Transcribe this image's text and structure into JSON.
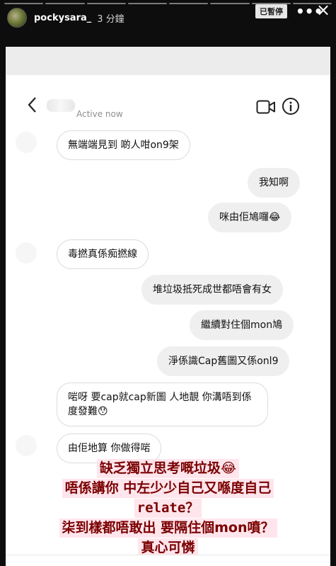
{
  "story": {
    "username": "pockysara_",
    "time": "3 分鐘",
    "paused_label": "已暫停",
    "more_icon": "more-dots-icon",
    "close_label": "×"
  },
  "dm": {
    "back_icon": "chevron-left-icon",
    "status": "Active now",
    "video_icon": "video-call-icon",
    "info_icon": "info-icon"
  },
  "messages": [
    {
      "side": "left",
      "text": "無端端見到 啲人咁on9架"
    },
    {
      "side": "right",
      "text": "我知啊"
    },
    {
      "side": "right",
      "text": "咪由佢鳩囉😂"
    },
    {
      "side": "left",
      "text": "毒撚真係痴撚線"
    },
    {
      "side": "right",
      "text": "堆垃圾抵死成世都唔會有女"
    },
    {
      "side": "right",
      "text": "繼續對住個mon鳩"
    },
    {
      "side": "right",
      "text": "淨係識Cap舊圖又係onl9"
    },
    {
      "side": "left",
      "text": "啱呀 要cap就cap新圖 人地靚 你溝唔到係度發難😯"
    },
    {
      "side": "left",
      "text": "由佢地算 你做得啱"
    }
  ],
  "caption": {
    "line1": "缺乏獨立思考嘅垃圾😂",
    "line2": "唔係講你  中左少少自己又喺度自己",
    "line3": "relate？",
    "line4": "柒到樣都唔敢出  要隔住個mon噴？",
    "line5": "真心可憐"
  }
}
